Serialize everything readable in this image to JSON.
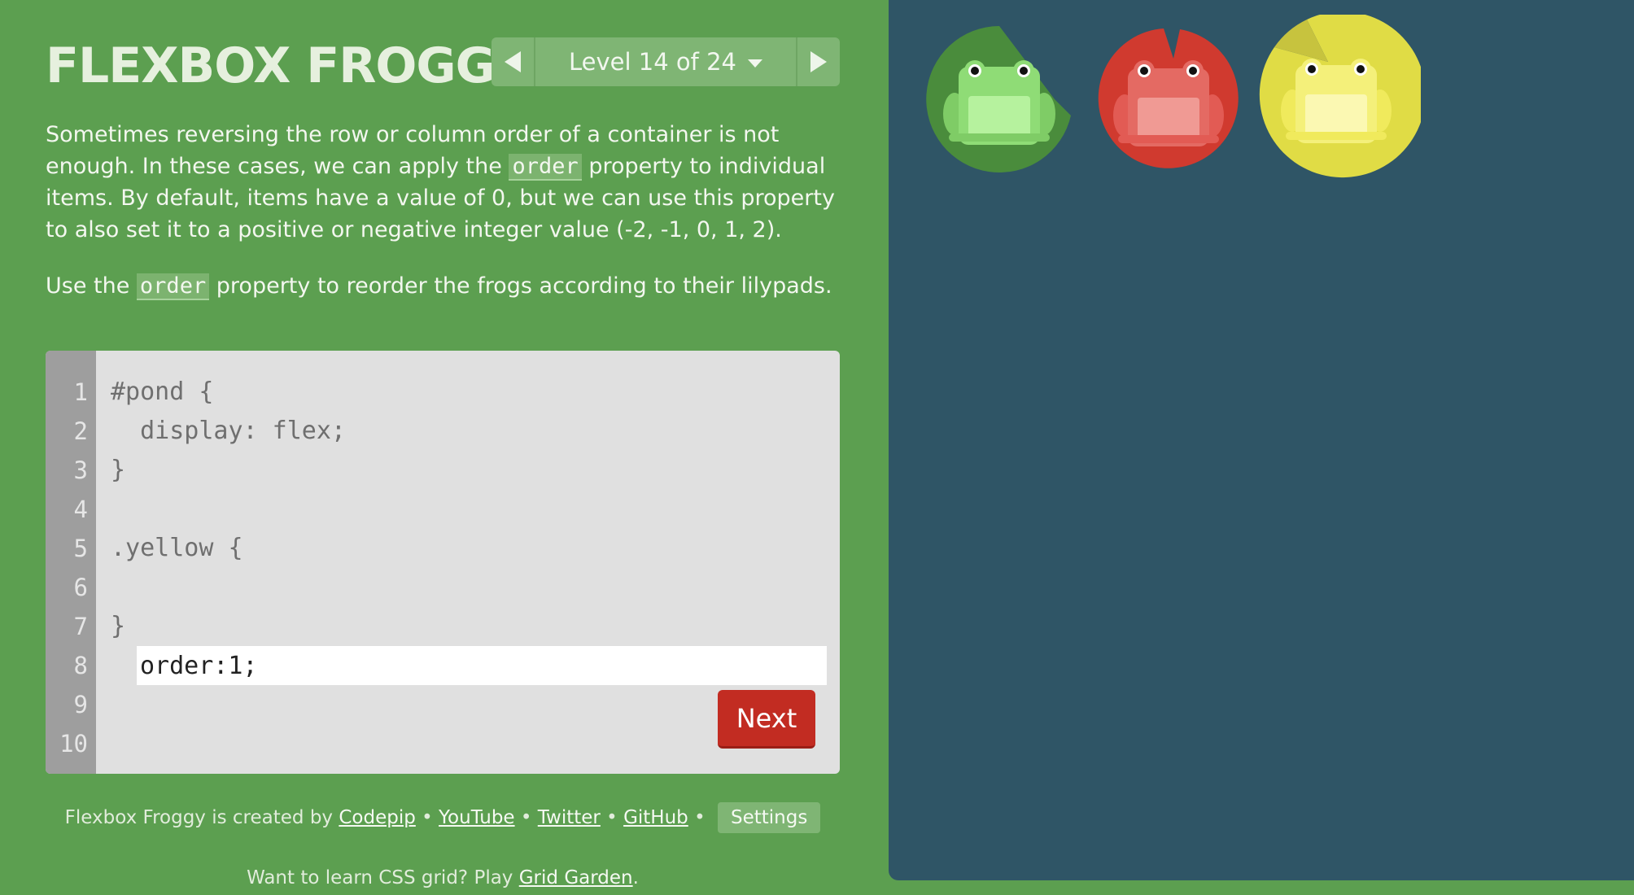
{
  "app": {
    "title": "FLEXBOX FROGGY"
  },
  "level_nav": {
    "label": "Level 14 of 24"
  },
  "instructions": {
    "p1_a": "Sometimes reversing the row or column order of a container is not enough. In these cases, we can apply the ",
    "p1_code": "order",
    "p1_b": " property to individual items. By default, items have a value of 0, but we can use this property to also set it to a positive or negative integer value (-2, -1, 0, 1, 2).",
    "p2_a": "Use the ",
    "p2_code": "order",
    "p2_b": " property to reorder the frogs according to their lilypads."
  },
  "editor": {
    "line_numbers": [
      "1",
      "2",
      "3",
      "4",
      "5",
      "6",
      "7",
      "8",
      "9",
      "10"
    ],
    "lines": {
      "l1": "#pond {",
      "l2": "  display: flex;",
      "l3": "}",
      "l4": "",
      "l5": ".yellow {",
      "l7": "}"
    },
    "input_value": "order:1;",
    "next_label": "Next"
  },
  "footer": {
    "prefix": "Flexbox Froggy is created by ",
    "codepip": "Codepip",
    "youtube": "YouTube",
    "twitter": "Twitter",
    "github": "GitHub",
    "separator": " • ",
    "settings": "Settings",
    "grid_prefix": "Want to learn CSS grid? Play ",
    "grid_link": "Grid Garden",
    "grid_suffix": "."
  },
  "pond": {
    "lilypads": [
      {
        "color": "green",
        "pad": "#4a8c3c"
      },
      {
        "color": "red",
        "pad": "#d03a2f"
      },
      {
        "color": "yellow",
        "pad": "#e0dc45"
      }
    ],
    "frogs": [
      {
        "color": "green",
        "body": "#a8e58c"
      },
      {
        "color": "red",
        "body": "#e46a63"
      },
      {
        "color": "yellow",
        "body": "#f4f07a"
      }
    ]
  }
}
